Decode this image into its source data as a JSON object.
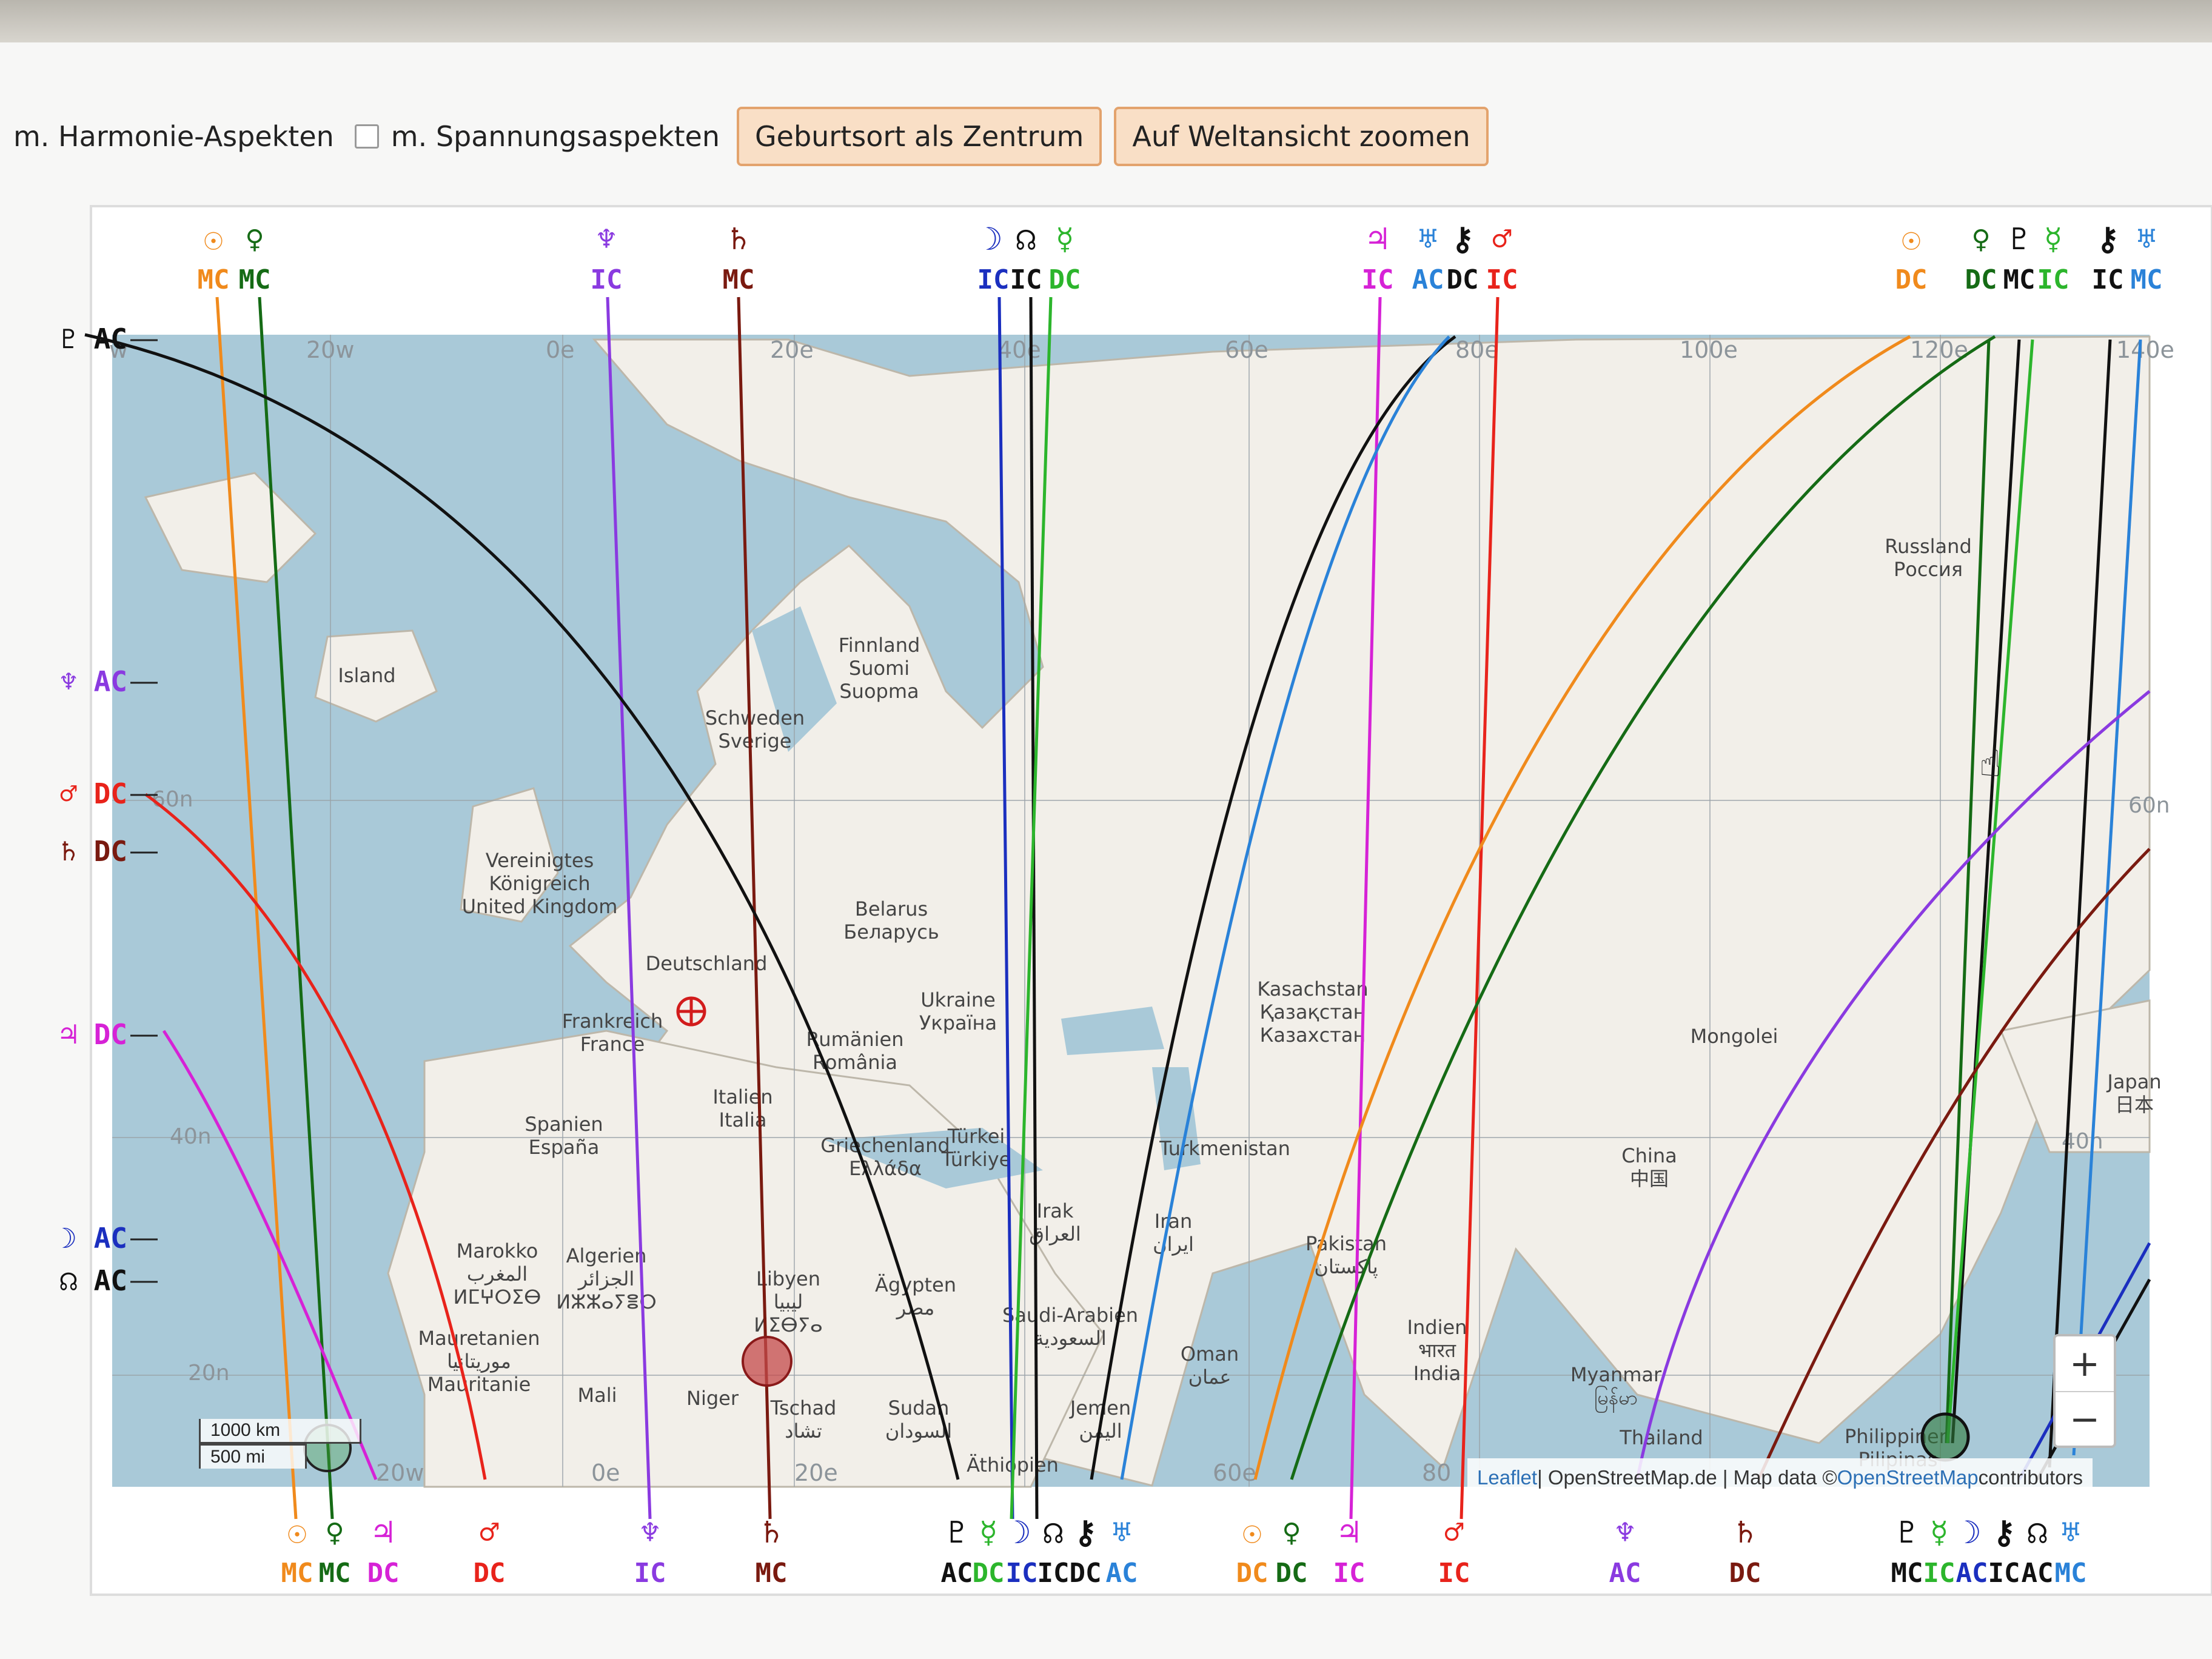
{
  "toolbar": {
    "harmonie_label": "m. Harmonie-Aspekten",
    "spannung_label": "m. Spannungsaspekten",
    "center_button": "Geburtsort als Zentrum",
    "world_button": "Auf Weltansicht zoomen"
  },
  "colors": {
    "sun": "#f08a1c",
    "moon": "#1b2fbf",
    "mercury": "#2cb52c",
    "venus": "#156b15",
    "mars": "#e8231b",
    "jupiter": "#d622d6",
    "saturn": "#7a1a10",
    "uranus": "#2a82d8",
    "neptune": "#8a3ae0",
    "pluto": "#111111",
    "node": "#111111",
    "chiron": "#111111"
  },
  "map": {
    "lat_labels": [
      "60n",
      "40n",
      "20n",
      "60n",
      "40n"
    ],
    "lon_labels": [
      "w",
      "20w",
      "0e",
      "20e",
      "40e",
      "60e",
      "80e",
      "100e",
      "120e",
      "140e",
      "20w",
      "0e",
      "20e",
      "60e",
      "80"
    ],
    "places": [
      {
        "text": "Island"
      },
      {
        "text": "Finnland\nSuomi\nSuopma"
      },
      {
        "text": "Schweden\nSverige"
      },
      {
        "text": "Vereinigtes\nKönigreich\nUnited Kingdom"
      },
      {
        "text": "Deutschland"
      },
      {
        "text": "Belarus\nБеларусь"
      },
      {
        "text": "Ukraine\nУкраїна"
      },
      {
        "text": "Frankreich\nFrance"
      },
      {
        "text": "Rumänien\nRomânia"
      },
      {
        "text": "Italien\nItalia"
      },
      {
        "text": "Spanien\nEspaña"
      },
      {
        "text": "Griechenland\nΕλλάδα"
      },
      {
        "text": "Türkei\nTürkiye"
      },
      {
        "text": "Turkmenistan"
      },
      {
        "text": "Kasachstan\nҚазақстан\nКазахстан"
      },
      {
        "text": "Russland\nРоссия"
      },
      {
        "text": "Mongolei"
      },
      {
        "text": "China\n中国"
      },
      {
        "text": "Marokko\nالمغرب\nⵍⵎⵖⵔⵉⴱ"
      },
      {
        "text": "Algerien\nالجزائر\nⵍⵣⵣⴰⵢⴻⵔ"
      },
      {
        "text": "Libyen\nليبيا\nⵍⵉⴱⵢⴰ"
      },
      {
        "text": "Ägypten\nمصر"
      },
      {
        "text": "Irak\nالعراق"
      },
      {
        "text": "Iran\nایران"
      },
      {
        "text": "Pakistan\nپاکستان"
      },
      {
        "text": "Saudi-Arabien\nالسعودية"
      },
      {
        "text": "Oman\nعمان"
      },
      {
        "text": "Indien\nभारत\nIndia"
      },
      {
        "text": "Mauretanien\nموريتانيا\nMauritanie"
      },
      {
        "text": "Mali"
      },
      {
        "text": "Niger"
      },
      {
        "text": "Tschad\nتشاد"
      },
      {
        "text": "Sudan\nالسودان"
      },
      {
        "text": "Jemen\nاليمن"
      },
      {
        "text": "Äthiopien"
      },
      {
        "text": "Myanmar\nမြန်မာ"
      },
      {
        "text": "Thailand"
      },
      {
        "text": "Philippinen\nPilipinas"
      },
      {
        "text": "Japan\n日本"
      }
    ],
    "scale_km": "1000 km",
    "scale_mi": "500 mi",
    "zoom_in": "+",
    "zoom_out": "−",
    "attribution_leaflet": "Leaflet",
    "attribution_sep1": " | OpenStreetMap.de | Map data © ",
    "attribution_osm": "OpenStreetMap",
    "attribution_tail": " contributors"
  },
  "astro_lines": {
    "top_labels": [
      {
        "glyph": "☉",
        "angle": "MC",
        "planet": "sun"
      },
      {
        "glyph": "♀",
        "angle": "MC",
        "planet": "venus"
      },
      {
        "glyph": "♆",
        "angle": "IC",
        "planet": "neptune"
      },
      {
        "glyph": "♄",
        "angle": "MC",
        "planet": "saturn"
      },
      {
        "glyph": "☽",
        "angle": "IC",
        "planet": "moon"
      },
      {
        "glyph": "☊",
        "angle": "IC",
        "planet": "node"
      },
      {
        "glyph": "☿",
        "angle": "DC",
        "planet": "mercury"
      },
      {
        "glyph": "♃",
        "angle": "IC",
        "planet": "jupiter"
      },
      {
        "glyph": "♅",
        "angle": "AC",
        "planet": "uranus"
      },
      {
        "glyph": "⚷",
        "angle": "DC",
        "planet": "chiron"
      },
      {
        "glyph": "♂",
        "angle": "IC",
        "planet": "mars"
      },
      {
        "glyph": "☉",
        "angle": "DC",
        "planet": "sun"
      },
      {
        "glyph": "♀",
        "angle": "DC",
        "planet": "venus"
      },
      {
        "glyph": "♇",
        "angle": "MC",
        "planet": "pluto"
      },
      {
        "glyph": "☿",
        "angle": "IC",
        "planet": "mercury"
      },
      {
        "glyph": "⚷",
        "angle": "IC",
        "planet": "chiron"
      },
      {
        "glyph": "♅",
        "angle": "MC",
        "planet": "uranus"
      }
    ],
    "left_labels": [
      {
        "glyph": "♇",
        "angle": "AC",
        "planet": "pluto"
      },
      {
        "glyph": "♆",
        "angle": "AC",
        "planet": "neptune"
      },
      {
        "glyph": "♂",
        "angle": "DC",
        "planet": "mars"
      },
      {
        "glyph": "♄",
        "angle": "DC",
        "planet": "saturn"
      },
      {
        "glyph": "♃",
        "angle": "DC",
        "planet": "jupiter"
      },
      {
        "glyph": "☽",
        "angle": "AC",
        "planet": "moon"
      },
      {
        "glyph": "☊",
        "angle": "AC",
        "planet": "node"
      }
    ],
    "bottom_labels": [
      {
        "glyph": "☉",
        "angle": "MC",
        "planet": "sun"
      },
      {
        "glyph": "♀",
        "angle": "MC",
        "planet": "venus"
      },
      {
        "glyph": "♃",
        "angle": "DC",
        "planet": "jupiter"
      },
      {
        "glyph": "♂",
        "angle": "DC",
        "planet": "mars"
      },
      {
        "glyph": "♆",
        "angle": "IC",
        "planet": "neptune"
      },
      {
        "glyph": "♄",
        "angle": "MC",
        "planet": "saturn"
      },
      {
        "glyph": "♇",
        "angle": "AC",
        "planet": "pluto"
      },
      {
        "glyph": "☿",
        "angle": "DC",
        "planet": "mercury"
      },
      {
        "glyph": "☽",
        "angle": "IC",
        "planet": "moon"
      },
      {
        "glyph": "☊",
        "angle": "IC",
        "planet": "node"
      },
      {
        "glyph": "⚷",
        "angle": "DC",
        "planet": "chiron"
      },
      {
        "glyph": "♅",
        "angle": "AC",
        "planet": "uranus"
      },
      {
        "glyph": "☉",
        "angle": "DC",
        "planet": "sun"
      },
      {
        "glyph": "♀",
        "angle": "DC",
        "planet": "venus"
      },
      {
        "glyph": "♃",
        "angle": "IC",
        "planet": "jupiter"
      },
      {
        "glyph": "♂",
        "angle": "IC",
        "planet": "mars"
      },
      {
        "glyph": "♆",
        "angle": "AC",
        "planet": "neptune"
      },
      {
        "glyph": "♄",
        "angle": "DC",
        "planet": "saturn"
      },
      {
        "glyph": "♇",
        "angle": "MC",
        "planet": "pluto"
      },
      {
        "glyph": "☿",
        "angle": "IC",
        "planet": "mercury"
      },
      {
        "glyph": "☽",
        "angle": "AC",
        "planet": "moon"
      },
      {
        "glyph": "⚷",
        "angle": "IC",
        "planet": "chiron"
      },
      {
        "glyph": "☊",
        "angle": "AC",
        "planet": "node"
      },
      {
        "glyph": "♅",
        "angle": "MC",
        "planet": "uranus"
      }
    ]
  }
}
